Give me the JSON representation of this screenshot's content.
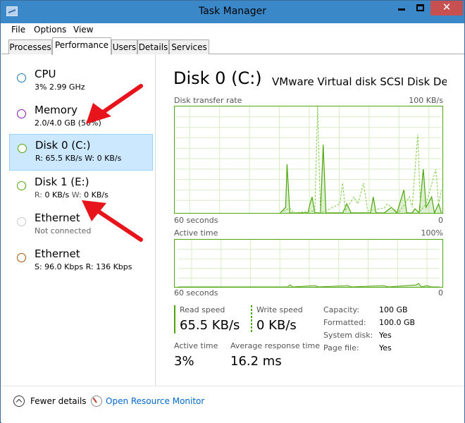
{
  "window": {
    "title": "Task Manager"
  },
  "menu": [
    "File",
    "Options",
    "View"
  ],
  "tabs": [
    "Processes",
    "Performance",
    "Users",
    "Details",
    "Services"
  ],
  "active_tab": "Performance",
  "resources": [
    {
      "name": "CPU",
      "sub": "3% 2.99 GHz",
      "circle_color": "#1779ba"
    },
    {
      "name": "Memory",
      "sub": "2.0/4.0 GB (50%)",
      "circle_color": "#8b12ae"
    },
    {
      "name": "Disk 0 (C:)",
      "sub": "R: 65.5 KB/s W: 0 KB/s",
      "circle_color": "#4da60c",
      "selected": true
    },
    {
      "name": "Disk 1 (E:)",
      "sub_r": "R:",
      "sub_r_val": "0 KB/s",
      "sub_w": "W:",
      "sub_w_val": "0 KB/s",
      "circle_color": "#4da60c"
    },
    {
      "name": "Ethernet",
      "sub": "Not connected",
      "circle_color": "#c8c8c8"
    },
    {
      "name": "Ethernet",
      "sub": "S: 96.0 Kbps R: 136 Kbps",
      "circle_color": "#a74f01"
    }
  ],
  "detail": {
    "title": "Disk 0 (C:)",
    "model": "VMware Virtual disk SCSI Disk De...",
    "graph1": {
      "label": "Disk transfer rate",
      "max": "100 KB/s",
      "time": "60 seconds",
      "min": "0"
    },
    "graph2": {
      "label": "Active time",
      "max": "100%",
      "time": "60 seconds",
      "min": "0"
    },
    "stats": {
      "read_label": "Read speed",
      "read_value": "65.5 KB/s",
      "write_label": "Write speed",
      "write_value": "0 KB/s",
      "active_label": "Active time",
      "active_value": "3%",
      "resp_label": "Average response time",
      "resp_value": "16.2 ms"
    },
    "props": [
      {
        "label": "Capacity:",
        "value": "100 GB"
      },
      {
        "label": "Formatted:",
        "value": "100.0 GB"
      },
      {
        "label": "System disk:",
        "value": "Yes"
      },
      {
        "label": "Page file:",
        "value": "Yes"
      }
    ]
  },
  "footer": {
    "fewer": "Fewer details",
    "resmon": "Open Resource Monitor"
  },
  "colors": {
    "accent": "#4da60c",
    "arrow": "#e8141c",
    "link": "#0066cc"
  }
}
